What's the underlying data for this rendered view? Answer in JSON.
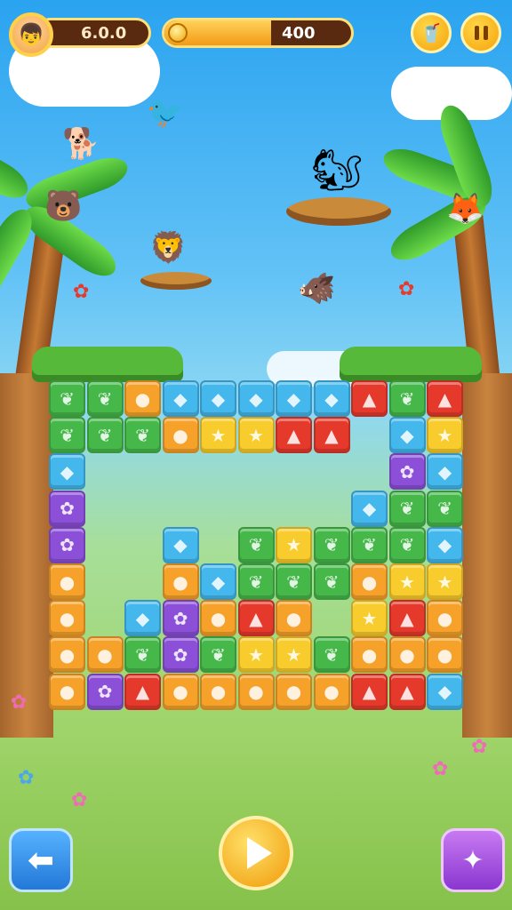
{
  "hud": {
    "score_text": "6.0.0",
    "progress_text": "400",
    "progress_level": 0.57,
    "avatar_icon": "boy-avatar",
    "coin_icon": "coin",
    "shop_icon": "cup-drink",
    "pause_icon": "pause"
  },
  "controls": {
    "back_icon": "arrow-left",
    "play_icon": "play-triangle",
    "magic_icon": "magic-wand"
  },
  "colors": {
    "sky_top": "#2aa3f0",
    "grass": "#86c24a",
    "orange": "#f6a22a",
    "yellow": "#f8cc2c",
    "green": "#46b84a",
    "red": "#e5392c",
    "blue": "#44b8ec",
    "purple": "#8b4fd8",
    "pink": "#f58ad0",
    "button_blue": "#2f8de8",
    "button_purple": "#a04ae0",
    "button_gold": "#f6b416"
  },
  "board": {
    "rows": 10,
    "cols": 11,
    "grid": [
      [
        "G",
        "G",
        "O",
        "B",
        "B",
        "B",
        "B",
        "B",
        "R",
        "G",
        "R"
      ],
      [
        "G",
        "G",
        "G",
        "O",
        "Y",
        "Y",
        "R",
        "R",
        "",
        "B",
        "Y"
      ],
      [
        "B",
        "",
        "",
        "",
        "",
        "",
        "",
        "",
        "",
        "P",
        "B"
      ],
      [
        "P",
        "",
        "",
        "",
        "",
        "",
        "",
        "",
        "B",
        "G",
        "G"
      ],
      [
        "P",
        "",
        "",
        "B",
        "",
        "G",
        "Y",
        "G",
        "G",
        "G",
        "B"
      ],
      [
        "O",
        "",
        "",
        "O",
        "B",
        "G",
        "G",
        "G",
        "O",
        "Y",
        "Y"
      ],
      [
        "O",
        "",
        "B",
        "P",
        "O",
        "R",
        "O",
        "",
        "Y",
        "R",
        "O"
      ],
      [
        "O",
        "O",
        "G",
        "P",
        "G",
        "Y",
        "Y",
        "G",
        "O",
        "O",
        "O"
      ],
      [
        "O",
        "P",
        "R",
        "O",
        "O",
        "O",
        "O",
        "O",
        "R",
        "R",
        "B"
      ],
      [
        "",
        "",
        "",
        "",
        "",
        "",
        "",
        "",
        "",
        "",
        ""
      ]
    ],
    "icons": {
      "G": "leaf",
      "O": "bear",
      "B": "gem",
      "R": "fox",
      "Y": "star",
      "P": "berry"
    }
  },
  "critters": [
    {
      "name": "purple-bird",
      "glyph": "🐦"
    },
    {
      "name": "orange-dog",
      "glyph": "🐕"
    },
    {
      "name": "tan-bear",
      "glyph": "🐻"
    },
    {
      "name": "lion-cub",
      "glyph": "🦁"
    },
    {
      "name": "squirrel",
      "glyph": "🐿"
    },
    {
      "name": "red-fox",
      "glyph": "🦊"
    },
    {
      "name": "brown-boar",
      "glyph": "🐗"
    }
  ]
}
